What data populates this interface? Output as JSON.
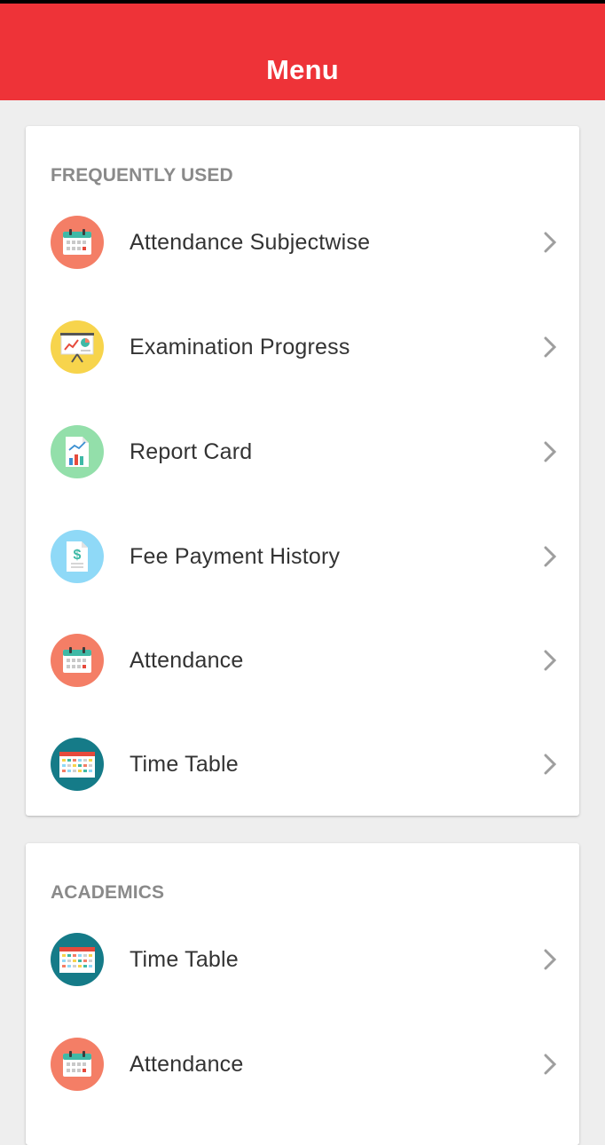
{
  "app": {
    "title": "Menu"
  },
  "sections": [
    {
      "title": "FREQUENTLY USED",
      "items": [
        {
          "label": "Attendance Subjectwise",
          "icon": "calendar-icon",
          "icon_bg": "#f47e66"
        },
        {
          "label": "Examination Progress",
          "icon": "presentation-board-icon",
          "icon_bg": "#f7d44c"
        },
        {
          "label": "Report Card",
          "icon": "report-chart-icon",
          "icon_bg": "#93dfaa"
        },
        {
          "label": "Fee Payment History",
          "icon": "dollar-document-icon",
          "icon_bg": "#8fd9f7"
        },
        {
          "label": "Attendance",
          "icon": "calendar-icon",
          "icon_bg": "#f47e66"
        },
        {
          "label": "Time Table",
          "icon": "timetable-icon",
          "icon_bg": "#157b88"
        }
      ]
    },
    {
      "title": "ACADEMICS",
      "items": [
        {
          "label": "Time Table",
          "icon": "timetable-icon",
          "icon_bg": "#157b88"
        },
        {
          "label": "Attendance",
          "icon": "calendar-icon",
          "icon_bg": "#f47e66"
        }
      ]
    }
  ],
  "colors": {
    "appbar": "#ee3338",
    "background": "#eeeeee",
    "chevron": "#9e9e9e",
    "section_title": "#8a8a8a"
  }
}
